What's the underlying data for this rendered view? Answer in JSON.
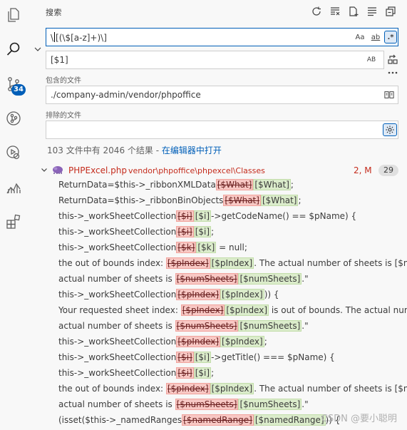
{
  "sidebar": {
    "title": "搜索",
    "source_control_badge": "34"
  },
  "search": {
    "query": "\\[(\\$[a-z]+)\\]",
    "replace": "[$1]",
    "case_label": "Aa",
    "word_label": "ab",
    "regex_label": ".*",
    "preserve_case_label": "AB"
  },
  "include": {
    "label": "包含的文件",
    "value": "./company-admin/vendor/phpoffice"
  },
  "exclude": {
    "label": "排除的文件",
    "value": ""
  },
  "summary": {
    "text": "103 文件中有 2046 个结果 - ",
    "link": "在编辑器中打开"
  },
  "file": {
    "name": "PHPExcel.php",
    "path": "vendor\\phpoffice\\phpexcel\\Classes",
    "status": "2, M",
    "count": "29"
  },
  "results": [
    {
      "pre": "ReturnData=$this->_ribbonXMLData",
      "del": "[$What]",
      "ins": "[$What]",
      "post": ";"
    },
    {
      "pre": "ReturnData=$this->_ribbonBinObjects",
      "del": "[$What]",
      "ins": "[$What]",
      "post": ";"
    },
    {
      "pre": "this->_workSheetCollection",
      "del": "[$i]",
      "ins": "[$i]",
      "post": "->getCodeName() == $pName) {"
    },
    {
      "pre": "this->_workSheetCollection",
      "del": "[$i]",
      "ins": "[$i]",
      "post": ";"
    },
    {
      "pre": "this->_workSheetCollection",
      "del": "[$k]",
      "ins": "[$k]",
      "post": " = null;"
    },
    {
      "pre": "the out of bounds index: ",
      "del": "[$pIndex]",
      "ins": "[$pIndex]",
      "post": ". The actual number of sheets is [$num..."
    },
    {
      "pre": "actual number of sheets is ",
      "del": "[$numSheets]",
      "ins": "[$numSheets]",
      "post": ".\""
    },
    {
      "pre": "this->_workSheetCollection",
      "del": "[$pIndex]",
      "ins": "[$pIndex]",
      "post": ")) {"
    },
    {
      "pre": "Your requested sheet index: ",
      "del": "[$pIndex]",
      "ins": "[$pIndex]",
      "post": " is out of bounds. The actual numbe..."
    },
    {
      "pre": "actual number of sheets is ",
      "del": "[$numSheets]",
      "ins": "[$numSheets]",
      "post": ".\""
    },
    {
      "pre": "this->_workSheetCollection",
      "del": "[$pIndex]",
      "ins": "[$pIndex]",
      "post": ";"
    },
    {
      "pre": "this->_workSheetCollection",
      "del": "[$i]",
      "ins": "[$i]",
      "post": "->getTitle() === $pName) {"
    },
    {
      "pre": "this->_workSheetCollection",
      "del": "[$i]",
      "ins": "[$i]",
      "post": ";"
    },
    {
      "pre": "the out of bounds index: ",
      "del": "[$pIndex]",
      "ins": "[$pIndex]",
      "post": ". The actual number of sheets is [$num..."
    },
    {
      "pre": "actual number of sheets is ",
      "del": "[$numSheets]",
      "ins": "[$numSheets]",
      "post": ".\""
    },
    {
      "pre": "(isset($this->_namedRanges",
      "del": "[$namedRange]",
      "ins": "[$namedRange]",
      "post": ")) {"
    }
  ],
  "watermark": "CSDN @要小聪明"
}
